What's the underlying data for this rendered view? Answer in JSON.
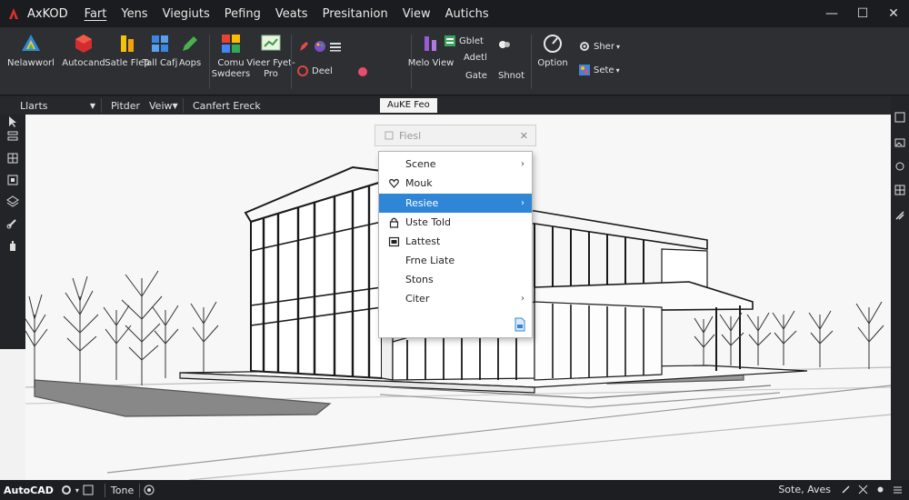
{
  "titlebar": {
    "app_title": "AxKOD",
    "menu": [
      "Fart",
      "Yens",
      "Viegiuts",
      "Pefing",
      "Veats",
      "Presitanion",
      "View",
      "Autichs"
    ],
    "active_menu_index": 0,
    "controls": {
      "minimize": "—",
      "maximize": "☐",
      "close": "✕"
    }
  },
  "ribbon": {
    "tools": [
      {
        "label": "Nelawworl",
        "icon": "triangle-logo-icon"
      },
      {
        "label": "Autocand",
        "icon": "red-cube-icon"
      },
      {
        "label": "Satle Flep",
        "icon": "yellow-bars-icon"
      },
      {
        "label": "Tall Cafj",
        "icon": "blue-grid-icon"
      },
      {
        "label": "Aops",
        "icon": "green-pencil-icon"
      },
      {
        "label": "Comu Swdeers",
        "icon": "color-squares-icon"
      },
      {
        "label": "Vieer Fyet-Pro",
        "icon": "chart-window-icon"
      },
      {
        "label": "Melo View",
        "icon": "purple-bars-icon"
      },
      {
        "label": "Option",
        "icon": "dial-icon"
      }
    ],
    "small_items": [
      {
        "label": "Deel",
        "icon": "red-circle-icon"
      },
      {
        "label": "Gblet",
        "icon": "green-box-icon"
      },
      {
        "label": "Adetl",
        "icon": "blank-icon"
      },
      {
        "label": "Gate",
        "icon": "blank-icon"
      },
      {
        "label": "Shnot",
        "icon": "blank-icon"
      },
      {
        "label": "Sher",
        "icon": "gear-icon"
      },
      {
        "label": "Sete",
        "icon": "palette-icon"
      }
    ]
  },
  "toolbar": {
    "dropdowns": [
      "Llarts",
      "Pitder",
      "Veiw",
      "Canfert Ereck"
    ],
    "view_label": "AuKE Feo"
  },
  "context_menu": {
    "header": "Fiesl",
    "items": [
      {
        "label": "Scene",
        "icon": "",
        "submenu": true
      },
      {
        "label": "Mouk",
        "icon": "heart-icon",
        "submenu": false
      },
      {
        "label": "Resiee",
        "icon": "",
        "submenu": true,
        "highlighted": true
      },
      {
        "label": "Uste Told",
        "icon": "lock-icon",
        "submenu": false
      },
      {
        "label": "Lattest",
        "icon": "calendar-icon",
        "submenu": false
      },
      {
        "label": "Frne Liate",
        "icon": "",
        "submenu": false
      },
      {
        "label": "Stons",
        "icon": "",
        "submenu": false
      },
      {
        "label": "Citer",
        "icon": "",
        "submenu": true
      }
    ]
  },
  "statusbar": {
    "app": "AutoCAD",
    "tab": "Tone",
    "coords": "Sote, Aves"
  },
  "colors": {
    "accent": "#2f86d6",
    "ribbon_bg": "#2d2f33",
    "titlebar_bg": "#1b1c1f"
  }
}
